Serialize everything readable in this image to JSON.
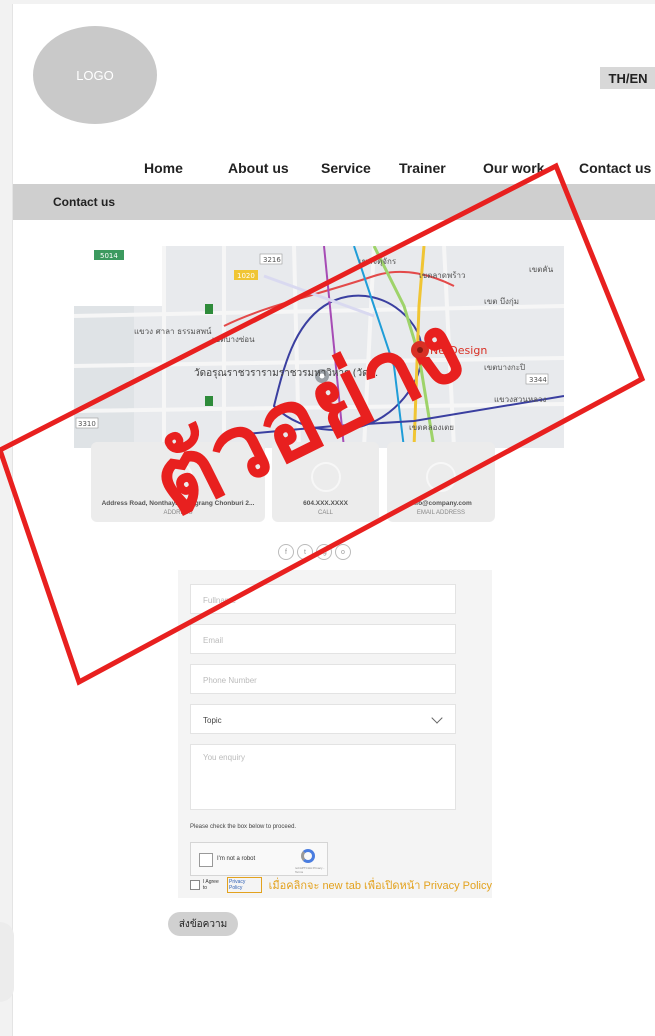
{
  "logo": {
    "text": "LOGO"
  },
  "lang_toggle": "TH/EN",
  "nav": {
    "items": [
      "Home",
      "About us",
      "Service",
      "Trainer",
      "Our work",
      "Contact us"
    ]
  },
  "section_title": "Contact us",
  "map": {
    "labels": [
      "5014",
      "3216",
      "1020",
      "เขตจตุจักร",
      "เขตลาดพร้าว",
      "เขตคัน",
      "เขต บึงกุ่ม",
      "แขวง ศาลา ธรรมสพน์",
      "เขตบางซ่อน",
      "NetDesign",
      "วัดอรุณราชวรารามราชวรมหาวิหาร (วัด...",
      "เขตบางกะปิ",
      "3344",
      "แขวงสวนหลวง",
      "เขตคลองเตย",
      "3310"
    ]
  },
  "cards": [
    {
      "value": "Address Road, Nonthaya, Bangrang Chonburi 2...",
      "label": "ADDRESS"
    },
    {
      "value": "604.XXX.XXXX",
      "label": "CALL"
    },
    {
      "value": "info@company.com",
      "label": "EMAIL ADDRESS"
    }
  ],
  "social": [
    "f",
    "t",
    "ig",
    "o"
  ],
  "form": {
    "fullname_placeholder": "Fullname",
    "email_placeholder": "Email",
    "phone_placeholder": "Phone Number",
    "topic_value": "Topic",
    "inquiry_placeholder": "You enquiry",
    "check_text": "Please check the box below to proceed.",
    "recaptcha_label": "I'm not a robot",
    "recaptcha_sub": "reCAPTCHA Privacy - Terms",
    "agree_text": "I Agree to",
    "privacy_link": "Privacy Policy",
    "privacy_note": "เมื่อคลิกจะ new tab เพื่อเปิดหน้า Privacy Policy",
    "submit": "ส่งข้อความ"
  },
  "watermark": "ตัวอย่าง",
  "colors": {
    "accent": "#e3a21e",
    "watermark": "#e8201f",
    "bar": "#cfcfcf"
  }
}
